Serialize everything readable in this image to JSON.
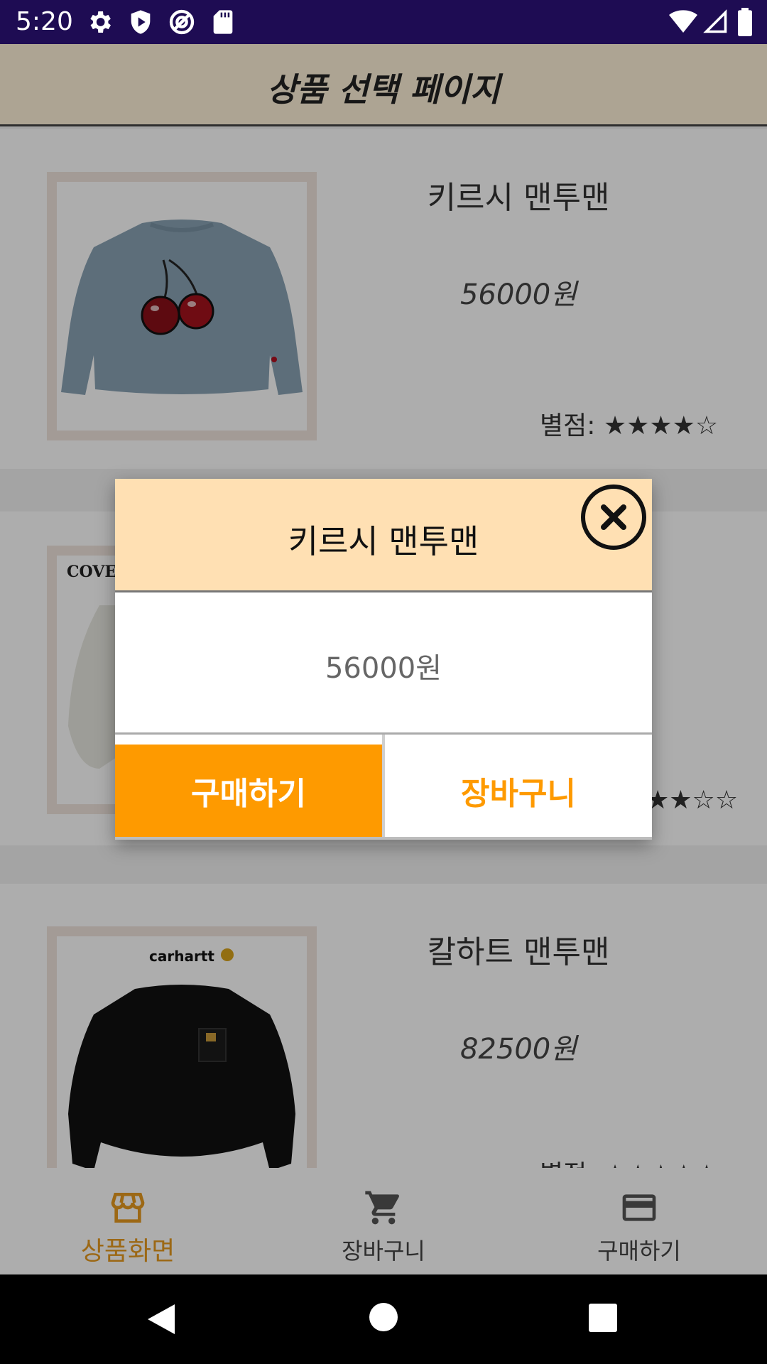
{
  "status_bar": {
    "time": "5:20",
    "left_icons": [
      "settings-icon",
      "play-protect-icon",
      "location-icon",
      "sd-card-icon"
    ],
    "right_icons": [
      "wifi-icon",
      "signal-icon",
      "battery-icon"
    ]
  },
  "app_bar": {
    "title": "상품 선택 페이지"
  },
  "products": [
    {
      "name": "키르시 맨투맨",
      "price": "56000원",
      "rating_label": "별점:",
      "rating_stars": "★★★★☆",
      "rating_value": 4,
      "rating_max": 5,
      "image": "sweatshirt-cherry-image"
    },
    {
      "name": "",
      "price": "",
      "rating_label": "",
      "rating_stars": "★★☆☆",
      "image": "sweatshirt-cover-image",
      "image_text": "COVER"
    },
    {
      "name": "칼하트 맨투맨",
      "price": "82500원",
      "rating_label": "별점:",
      "rating_stars": "★★★★★",
      "image": "sweatshirt-carhartt-image",
      "image_text": "carhartt"
    }
  ],
  "dialog": {
    "title": "키르시 맨투맨",
    "price": "56000원",
    "close_icon": "close-circle-icon",
    "buy_label": "구매하기",
    "cart_label": "장바구니"
  },
  "bottom_nav": {
    "items": [
      {
        "label": "상품화면",
        "icon": "store-icon",
        "active": true
      },
      {
        "label": "장바구니",
        "icon": "cart-icon",
        "active": false
      },
      {
        "label": "구매하기",
        "icon": "credit-card-icon",
        "active": false
      }
    ]
  },
  "system_nav": {
    "buttons": [
      "back-icon",
      "home-icon",
      "recents-icon"
    ]
  },
  "colors": {
    "status_bar": "#1e0c53",
    "app_bar": "#fff2d9",
    "accent": "#fe9a00",
    "dialog_header": "#ffe0b3",
    "nav_active": "#e69a1f"
  }
}
